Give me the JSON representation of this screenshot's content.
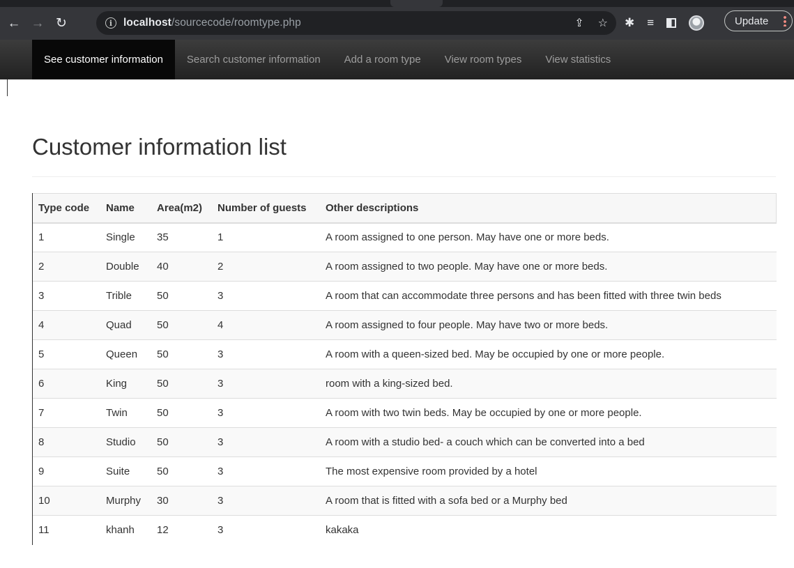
{
  "browser": {
    "url_host": "localhost",
    "url_path": "/sourcecode/roomtype.php",
    "update_label": "Update",
    "icons": [
      "back-arrow-icon",
      "forward-arrow-icon",
      "reload-icon",
      "info-icon",
      "share-icon",
      "star-icon",
      "extensions-icon",
      "reading-list-icon",
      "side-panel-icon",
      "profile-avatar",
      "more-menu-icon"
    ]
  },
  "navbar": {
    "items": [
      {
        "label": "See customer information",
        "active": true
      },
      {
        "label": "Search customer information",
        "active": false
      },
      {
        "label": "Add a room type",
        "active": false
      },
      {
        "label": "View room types",
        "active": false
      },
      {
        "label": "View statistics",
        "active": false
      }
    ]
  },
  "page": {
    "title": "Customer information list"
  },
  "table": {
    "headers": [
      "Type code",
      "Name",
      "Area(m2)",
      "Number of guests",
      "Other descriptions"
    ],
    "rows": [
      [
        "1",
        "Single",
        "35",
        "1",
        "A room assigned to one person. May have one or more beds."
      ],
      [
        "2",
        "Double",
        "40",
        "2",
        "A room assigned to two people. May have one or more beds."
      ],
      [
        "3",
        "Trible",
        "50",
        "3",
        "A room that can accommodate three persons and has been fitted with three twin beds"
      ],
      [
        "4",
        "Quad",
        "50",
        "4",
        "A room assigned to four people. May have two or more beds."
      ],
      [
        "5",
        "Queen",
        "50",
        "3",
        "A room with a queen-sized bed. May be occupied by one or more people."
      ],
      [
        "6",
        "King",
        "50",
        "3",
        "room with a king-sized bed."
      ],
      [
        "7",
        "Twin",
        "50",
        "3",
        "A room with two twin beds. May be occupied by one or more people."
      ],
      [
        "8",
        "Studio",
        "50",
        "3",
        "A room with a studio bed- a couch which can be converted into a bed"
      ],
      [
        "9",
        "Suite",
        "50",
        "3",
        "The most expensive room provided by a hotel"
      ],
      [
        "10",
        "Murphy",
        "30",
        "3",
        "A room that is fitted with a sofa bed or a Murphy bed"
      ],
      [
        "11",
        "khanh",
        "12",
        "3",
        "kakaka"
      ]
    ]
  }
}
